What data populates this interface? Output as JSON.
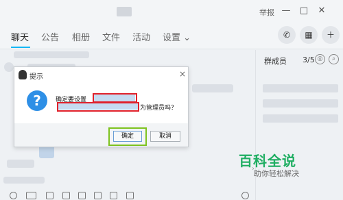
{
  "window": {
    "report_label": "举报",
    "minimize_icon": "minimize-icon",
    "maximize_icon": "maximize-icon",
    "close_icon": "close-icon"
  },
  "tabs": [
    {
      "label": "聊天",
      "active": true
    },
    {
      "label": "公告"
    },
    {
      "label": "相册"
    },
    {
      "label": "文件"
    },
    {
      "label": "活动"
    },
    {
      "label": "设置 ⌄"
    }
  ],
  "header_actions": [
    {
      "icon": "phone-icon",
      "glyph": "✆"
    },
    {
      "icon": "apps-icon",
      "glyph": "▦"
    },
    {
      "icon": "add-icon",
      "glyph": "＋"
    }
  ],
  "members": {
    "title": "群成员",
    "count": "3/5"
  },
  "dialog": {
    "title": "提示",
    "close_glyph": "×",
    "message_prefix": "确定要设置",
    "message_suffix": "为管理员吗？",
    "question_glyph": "?",
    "confirm_label": "确定",
    "cancel_label": "取消"
  },
  "watermark": {
    "logo_text": "百科全说",
    "subtitle": "助你轻松解决"
  },
  "colors": {
    "accent": "#12b7f5",
    "highlight_red": "#e0202a",
    "highlight_green": "#7dc21e",
    "brand_green": "#1fae62"
  }
}
